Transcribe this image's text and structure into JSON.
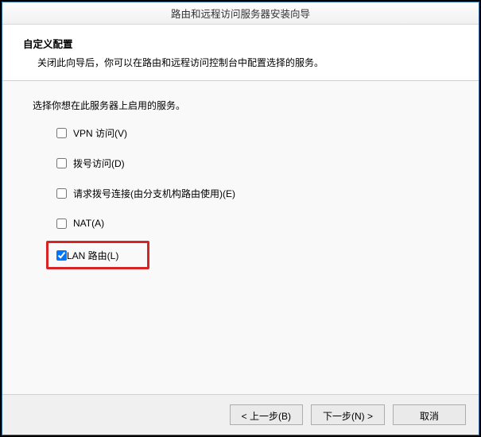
{
  "titlebar": {
    "text": "路由和远程访问服务器安装向导"
  },
  "header": {
    "title": "自定义配置",
    "subtitle": "关闭此向导后，你可以在路由和远程访问控制台中配置选择的服务。"
  },
  "content": {
    "instruction": "选择你想在此服务器上启用的服务。",
    "options": [
      {
        "label": "VPN 访问(V)",
        "checked": false
      },
      {
        "label": "拨号访问(D)",
        "checked": false
      },
      {
        "label": "请求拨号连接(由分支机构路由使用)(E)",
        "checked": false
      },
      {
        "label": "NAT(A)",
        "checked": false
      },
      {
        "label": "LAN 路由(L)",
        "checked": true
      }
    ]
  },
  "buttons": {
    "back": "< 上一步(B)",
    "next": "下一步(N) >",
    "cancel": "取消"
  }
}
